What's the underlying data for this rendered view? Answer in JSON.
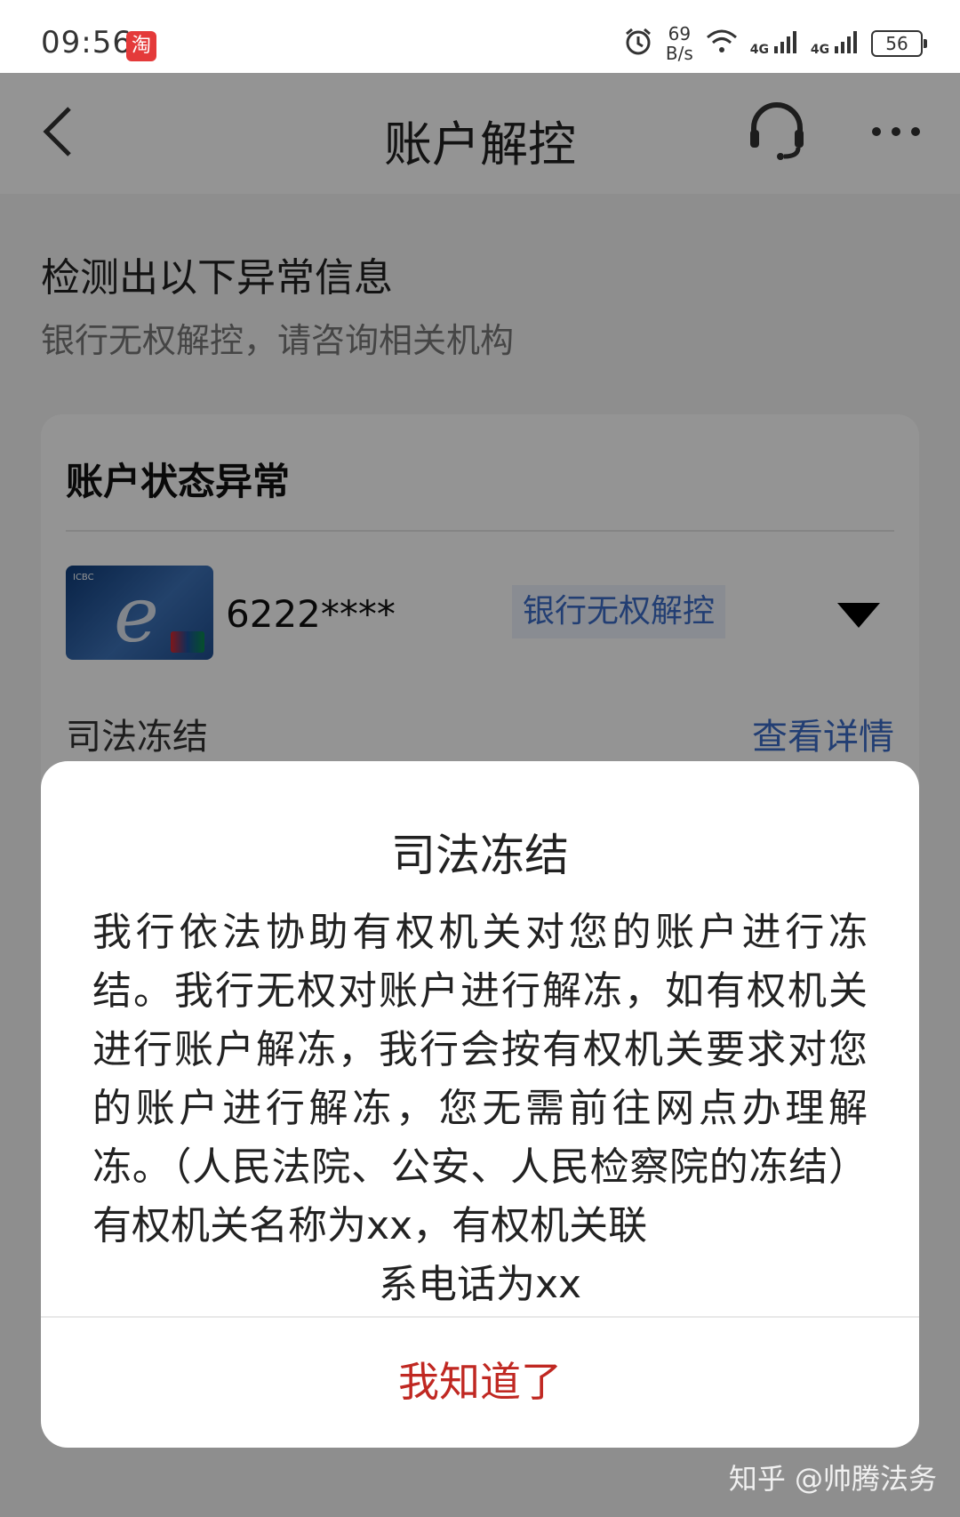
{
  "status_bar": {
    "time": "09:56",
    "app_badge": "淘",
    "net_speed_value": "69",
    "net_speed_unit": "B/s",
    "signal_1": "4G",
    "signal_2": "4G",
    "battery": "56"
  },
  "nav": {
    "title": "账户解控",
    "back_icon": "chevron-left-icon",
    "support_icon": "headset-icon",
    "more_icon": "more-dots-icon"
  },
  "notice": {
    "title": "检测出以下异常信息",
    "subtitle": "银行无权解控，请咨询相关机构"
  },
  "account_card": {
    "title": "账户状态异常",
    "card_number": "6222****",
    "badge": "银行无权解控",
    "freeze_label": "司法冻结",
    "details_link": "查看详情"
  },
  "dialog": {
    "title": "司法冻结",
    "body": "我行依法协助有权机关对您的账户进行冻结。我行无权对账户进行解冻，如有权机关进行账户解冻，我行会按有权机关要求对您的账户进行解冻，您无需前往网点办理解冻。（人民法院、公安、人民检察院的冻结）有权机关名称为xx，有权机关联",
    "body_last_line": "系电话为xx",
    "confirm_button": "我知道了"
  },
  "watermark": "知乎 @帅腾法务",
  "colors": {
    "accent_red": "#c02822",
    "link_blue": "#3b6cc6",
    "overlay": "rgba(0,0,0,0.42)"
  }
}
